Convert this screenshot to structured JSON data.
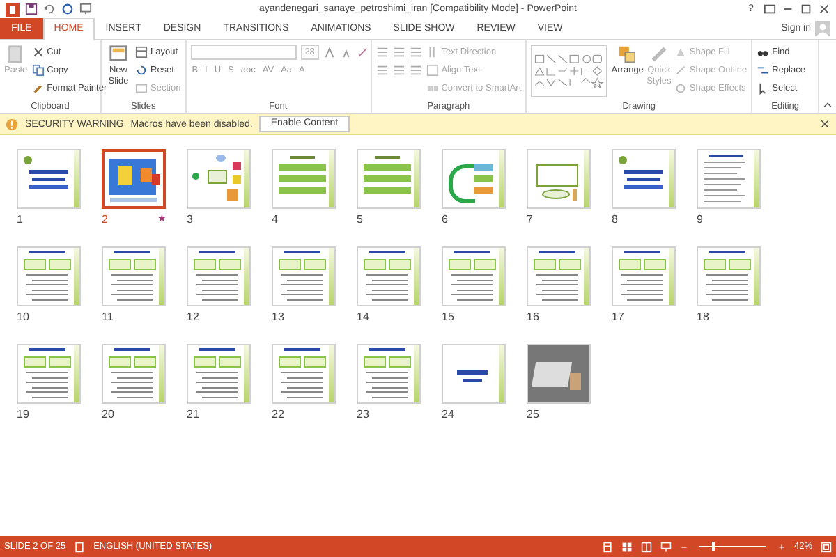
{
  "title_bar": {
    "title": "ayandenegari_sanaye_petroshimi_iran [Compatibility Mode] - PowerPoint",
    "help": "?"
  },
  "file_tab": "FILE",
  "tabs": [
    {
      "label": "HOME",
      "selected": true
    },
    {
      "label": "INSERT",
      "selected": false
    },
    {
      "label": "DESIGN",
      "selected": false
    },
    {
      "label": "TRANSITIONS",
      "selected": false
    },
    {
      "label": "ANIMATIONS",
      "selected": false
    },
    {
      "label": "SLIDE SHOW",
      "selected": false
    },
    {
      "label": "REVIEW",
      "selected": false
    },
    {
      "label": "VIEW",
      "selected": false
    }
  ],
  "sign_in": "Sign in",
  "ribbon": {
    "groups": [
      {
        "kind": "clipboard",
        "label": "Clipboard",
        "items": [
          {
            "label": "Paste",
            "disabled": true
          },
          {
            "label": "Cut",
            "disabled": false
          },
          {
            "label": "Copy",
            "disabled": false
          },
          {
            "label": "Format Painter",
            "disabled": false
          }
        ]
      },
      {
        "kind": "slides",
        "label": "Slides",
        "items": [
          {
            "label": "New Slide",
            "disabled": false
          },
          {
            "label": "Layout",
            "disabled": false
          },
          {
            "label": "Reset",
            "disabled": false
          },
          {
            "label": "Section",
            "disabled": true
          }
        ]
      },
      {
        "kind": "font",
        "label": "Font",
        "font_size": "28",
        "buttons": [
          "B",
          "I",
          "U",
          "S",
          "abc",
          "AV",
          "Aa",
          "A"
        ]
      },
      {
        "kind": "paragraph",
        "label": "Paragraph",
        "items": [
          {
            "label": "Text Direction",
            "disabled": true
          },
          {
            "label": "Align Text",
            "disabled": true
          },
          {
            "label": "Convert to SmartArt",
            "disabled": true
          }
        ]
      },
      {
        "kind": "drawing",
        "label": "Drawing",
        "items": [
          {
            "label": "Arrange",
            "disabled": false
          },
          {
            "label": "Quick Styles",
            "disabled": true
          },
          {
            "label": "Shape Fill",
            "disabled": true
          },
          {
            "label": "Shape Outline",
            "disabled": true
          },
          {
            "label": "Shape Effects",
            "disabled": true
          }
        ]
      },
      {
        "kind": "editing",
        "label": "Editing",
        "items": [
          {
            "label": "Find",
            "disabled": false
          },
          {
            "label": "Replace",
            "disabled": false
          },
          {
            "label": "Select",
            "disabled": false
          }
        ]
      }
    ]
  },
  "warning": {
    "title": "SECURITY WARNING",
    "message": "Macros have been disabled.",
    "button": "Enable Content"
  },
  "slides": [
    {
      "number": "1",
      "kind": "title",
      "selected": false
    },
    {
      "number": "2",
      "kind": "diagram",
      "selected": true,
      "mark": "★"
    },
    {
      "number": "3",
      "kind": "flowchart",
      "selected": false
    },
    {
      "number": "4",
      "kind": "list",
      "selected": false
    },
    {
      "number": "5",
      "kind": "list",
      "selected": false
    },
    {
      "number": "6",
      "kind": "arrow",
      "selected": false
    },
    {
      "number": "7",
      "kind": "callout",
      "selected": false
    },
    {
      "number": "8",
      "kind": "title",
      "selected": false
    },
    {
      "number": "9",
      "kind": "text",
      "selected": false
    },
    {
      "number": "10",
      "kind": "boxes",
      "selected": false
    },
    {
      "number": "11",
      "kind": "boxes",
      "selected": false
    },
    {
      "number": "12",
      "kind": "boxes",
      "selected": false
    },
    {
      "number": "13",
      "kind": "boxes",
      "selected": false
    },
    {
      "number": "14",
      "kind": "boxes",
      "selected": false
    },
    {
      "number": "15",
      "kind": "boxes",
      "selected": false
    },
    {
      "number": "16",
      "kind": "boxes",
      "selected": false
    },
    {
      "number": "17",
      "kind": "boxes",
      "selected": false
    },
    {
      "number": "18",
      "kind": "boxes",
      "selected": false
    },
    {
      "number": "19",
      "kind": "boxes",
      "selected": false
    },
    {
      "number": "20",
      "kind": "boxes",
      "selected": false
    },
    {
      "number": "21",
      "kind": "boxes",
      "selected": false
    },
    {
      "number": "22",
      "kind": "boxes",
      "selected": false
    },
    {
      "number": "23",
      "kind": "boxes",
      "selected": false
    },
    {
      "number": "24",
      "kind": "end",
      "selected": false
    },
    {
      "number": "25",
      "kind": "photo",
      "selected": false
    }
  ],
  "status_bar": {
    "slide": "SLIDE 2 OF 25",
    "language": "ENGLISH (UNITED STATES)",
    "zoom": "42%",
    "zoom_level": {
      "level": 0.2
    }
  }
}
